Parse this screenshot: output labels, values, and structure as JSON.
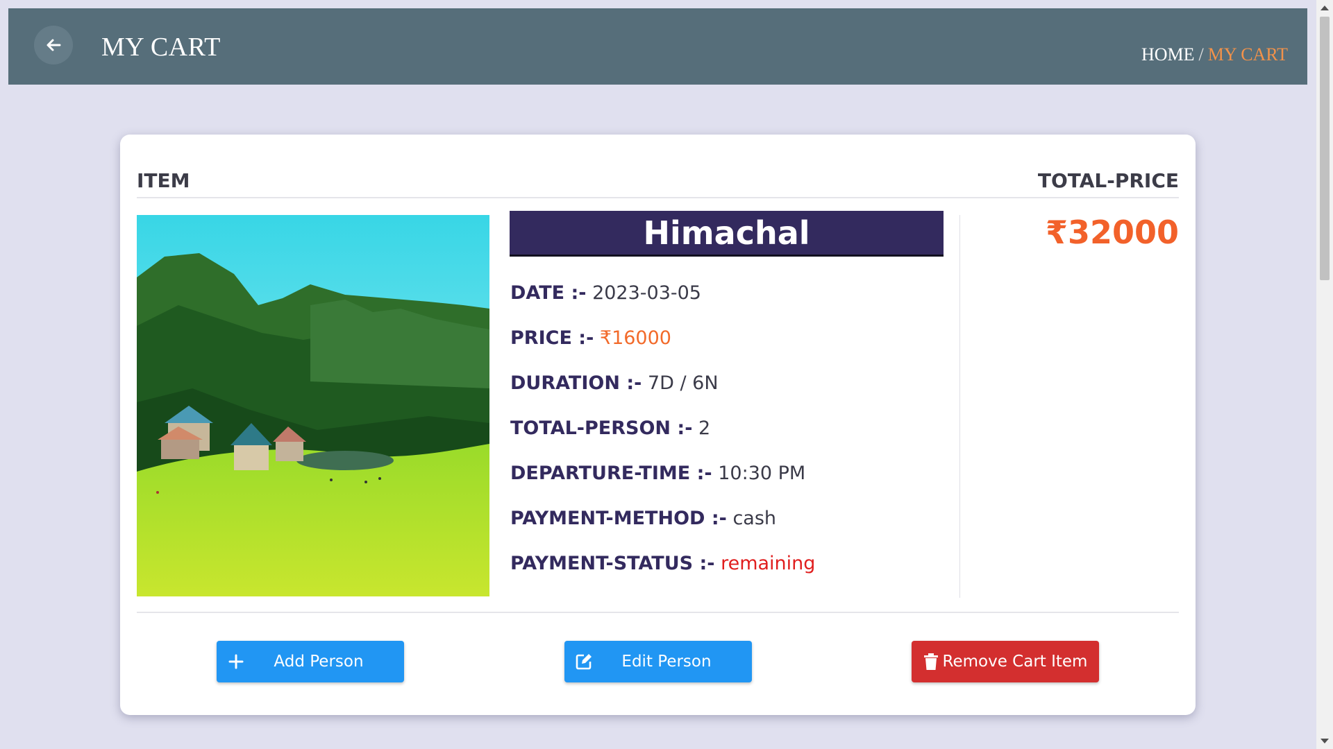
{
  "header": {
    "title": "MY CART",
    "breadcrumb": {
      "home": "HOME",
      "separator": "/",
      "current": "MY CART"
    }
  },
  "cart": {
    "columns": {
      "item": "ITEM",
      "total": "TOTAL-PRICE"
    },
    "item": {
      "destination": "Himachal",
      "image_icon": "mountain-meadow-photo",
      "details": [
        {
          "label": "DATE :-",
          "value": "2023-03-05"
        },
        {
          "label": "PRICE :-",
          "value": "₹16000"
        },
        {
          "label": "DURATION :-",
          "value": "7D / 6N"
        },
        {
          "label": "TOTAL-PERSON :-",
          "value": "2"
        },
        {
          "label": "DEPARTURE-TIME :-",
          "value": "10:30 PM"
        },
        {
          "label": "PAYMENT-METHOD :-",
          "value": "cash"
        },
        {
          "label": "PAYMENT-STATUS :-",
          "value": "remaining"
        }
      ],
      "total_price": "₹32000"
    },
    "buttons": {
      "add": "Add Person",
      "edit": "Edit Person",
      "remove": "Remove Cart Item"
    }
  },
  "colors": {
    "header_bg": "#566e7a",
    "banner_bg": "#332a5e",
    "accent_orange": "#f2612a",
    "status_red": "#e01e1e",
    "button_blue": "#2196f3",
    "button_red": "#d32f2f"
  }
}
